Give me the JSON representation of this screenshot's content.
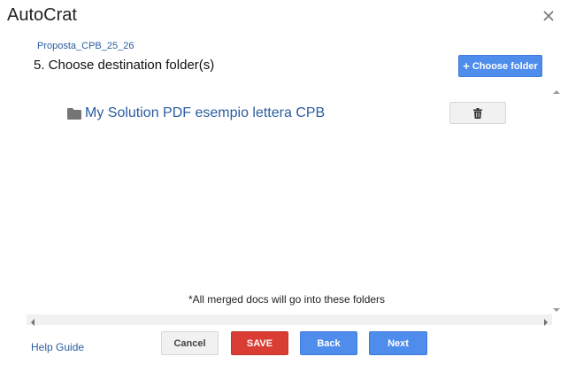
{
  "dialog": {
    "title": "AutoCrat",
    "close_icon": "close-icon"
  },
  "header": {
    "job_name": "Proposta_CPB_25_26",
    "step_title": "5. Choose destination folder(s)",
    "choose_folder_label": "Choose folder",
    "choose_folder_icon": "plus-icon"
  },
  "folders": [
    {
      "icon": "folder-icon",
      "name": "My Solution PDF esempio lettera CPB",
      "delete_icon": "trash-icon"
    }
  ],
  "note": "*All merged docs will go into these folders",
  "footer": {
    "help_label": "Help Guide",
    "cancel_label": "Cancel",
    "save_label": "SAVE",
    "back_label": "Back",
    "next_label": "Next"
  },
  "colors": {
    "primary": "#4f8ded",
    "danger": "#d93d34",
    "link": "#2a5d9f",
    "neutral_button": "#f1f1f1"
  }
}
